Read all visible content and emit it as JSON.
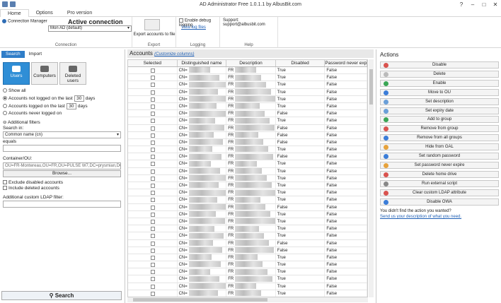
{
  "window": {
    "title": "AD Administrator Free 1.0.1.1 by AlbusBit.com",
    "help": "?",
    "minimize": "–",
    "maximize": "□",
    "close": "✕"
  },
  "tabs": [
    "Home",
    "Options",
    "Pro version"
  ],
  "ribbon": {
    "connection_manager": "Connection Manager",
    "active_connection_title": "Active connection",
    "active_connection_value": "Mon AD (default)",
    "connection_label": "Connection",
    "export_label": "Export accounts to file",
    "export_group": "Export",
    "debug_label": "Enable debug logging",
    "view_log": "View log files",
    "logging_group": "Logging",
    "support": "Support: support@albusbit.com",
    "help_group": "Help"
  },
  "left": {
    "tabs": [
      "Search",
      "Import"
    ],
    "categories": [
      "Users",
      "Computers",
      "Deleted users"
    ],
    "show_all": "Show all",
    "not_logged_prefix": "Accounts not logged on the last",
    "not_logged_days": "30",
    "days": "days",
    "logged_prefix": "Accounts logged on the last",
    "logged_days": "30",
    "never_logged": "Accounts never logged on",
    "additional_filters": "Additional filters",
    "search_in": "Search in:",
    "search_in_value": "Common name (cn)",
    "equals": "equals",
    "container_label": "Container/OU:",
    "container_value": "OU=FR-Montereau,OU=FR,OU=PULSE W7,DC=prysmian,DC",
    "browse": "Browse...",
    "exclude_disabled": "Exclude disabled accounts",
    "include_deleted": "Include deleted accounts",
    "custom_ldap": "Additional custom LDAP filter:",
    "search_button": "Search"
  },
  "center": {
    "title": "Accounts",
    "customize": "(Customize columns)",
    "columns": [
      "Selected",
      "Distinguished name",
      "Description",
      "Disabled",
      "Password never exp"
    ],
    "rows": [
      {
        "dn": "CN=",
        "desc": "FR",
        "disabled": "True",
        "pne": "False"
      },
      {
        "dn": "CN=",
        "desc": "FR",
        "disabled": "True",
        "pne": "False"
      },
      {
        "dn": "CN=",
        "desc": "FR",
        "disabled": "True",
        "pne": "False"
      },
      {
        "dn": "CN=",
        "desc": "FR",
        "disabled": "True",
        "pne": "False"
      },
      {
        "dn": "CN=",
        "desc": "FR",
        "disabled": "True",
        "pne": "False"
      },
      {
        "dn": "CN=",
        "desc": "FR",
        "disabled": "True",
        "pne": "False"
      },
      {
        "dn": "CN=",
        "desc": "FR",
        "disabled": "False",
        "pne": "False"
      },
      {
        "dn": "CN=",
        "desc": "FR",
        "disabled": "True",
        "pne": "False"
      },
      {
        "dn": "CN=",
        "desc": "FR",
        "disabled": "False",
        "pne": "False"
      },
      {
        "dn": "CN=",
        "desc": "FR",
        "disabled": "False",
        "pne": "False"
      },
      {
        "dn": "CN=",
        "desc": "FR",
        "disabled": "False",
        "pne": "False"
      },
      {
        "dn": "CN=",
        "desc": "FR",
        "disabled": "True",
        "pne": "False"
      },
      {
        "dn": "CN=",
        "desc": "FR",
        "disabled": "False",
        "pne": "False"
      },
      {
        "dn": "CN=",
        "desc": "FR",
        "disabled": "True",
        "pne": "False"
      },
      {
        "dn": "CN=",
        "desc": "FR",
        "disabled": "True",
        "pne": "False"
      },
      {
        "dn": "CN=",
        "desc": "FR",
        "disabled": "True",
        "pne": "False"
      },
      {
        "dn": "CN=",
        "desc": "FR",
        "disabled": "True",
        "pne": "False"
      },
      {
        "dn": "CN=",
        "desc": "FR",
        "disabled": "True",
        "pne": "False"
      },
      {
        "dn": "CN=",
        "desc": "FR",
        "disabled": "True",
        "pne": "False"
      },
      {
        "dn": "CN=",
        "desc": "FR",
        "disabled": "False",
        "pne": "False"
      },
      {
        "dn": "CN=",
        "desc": "FR",
        "disabled": "True",
        "pne": "False"
      },
      {
        "dn": "CN=",
        "desc": "FR",
        "disabled": "True",
        "pne": "False"
      },
      {
        "dn": "CN=",
        "desc": "FR",
        "disabled": "True",
        "pne": "False"
      },
      {
        "dn": "CN=",
        "desc": "FR",
        "disabled": "True",
        "pne": "False"
      },
      {
        "dn": "CN=",
        "desc": "FR",
        "disabled": "False",
        "pne": "False"
      },
      {
        "dn": "CN=",
        "desc": "FR",
        "disabled": "False",
        "pne": "False"
      },
      {
        "dn": "CN=",
        "desc": "FR",
        "disabled": "True",
        "pne": "False"
      },
      {
        "dn": "CN=",
        "desc": "FR",
        "disabled": "True",
        "pne": "False"
      },
      {
        "dn": "CN=",
        "desc": "FR",
        "disabled": "True",
        "pne": "False"
      },
      {
        "dn": "CN=",
        "desc": "FR",
        "disabled": "True",
        "pne": "False"
      },
      {
        "dn": "CN=",
        "desc": "FR",
        "disabled": "True",
        "pne": "False"
      },
      {
        "dn": "CN=",
        "desc": "FR",
        "disabled": "True",
        "pne": "False"
      }
    ]
  },
  "right": {
    "title": "Actions",
    "actions": [
      {
        "label": "Disable",
        "color": "#d9534f"
      },
      {
        "label": "Delete",
        "color": "#bbbbbb"
      },
      {
        "label": "Enable",
        "color": "#3aa655"
      },
      {
        "label": "Move to OU",
        "color": "#3b7dd8"
      },
      {
        "label": "Set description",
        "color": "#6a9fd8"
      },
      {
        "label": "Set expiry date",
        "color": "#6a9fd8"
      },
      {
        "label": "Add to group",
        "color": "#3aa655"
      },
      {
        "label": "Remove from group",
        "color": "#d9534f"
      },
      {
        "label": "Remove from all groups",
        "color": "#3b7dd8"
      },
      {
        "label": "Hide from GAL",
        "color": "#e6a23c"
      },
      {
        "label": "Set random password",
        "color": "#3b7dd8"
      },
      {
        "label": "Set password never expire",
        "color": "#e6a23c"
      },
      {
        "label": "Delete home drive",
        "color": "#d9534f"
      },
      {
        "label": "Run external script",
        "color": "#888888"
      },
      {
        "label": "Clear custom LDAP attribute",
        "color": "#d9534f"
      },
      {
        "label": "Disable OWA",
        "color": "#3b7dd8"
      }
    ],
    "note": "You didn't find the action you wanted?",
    "link": "Send us your description of what you need."
  }
}
